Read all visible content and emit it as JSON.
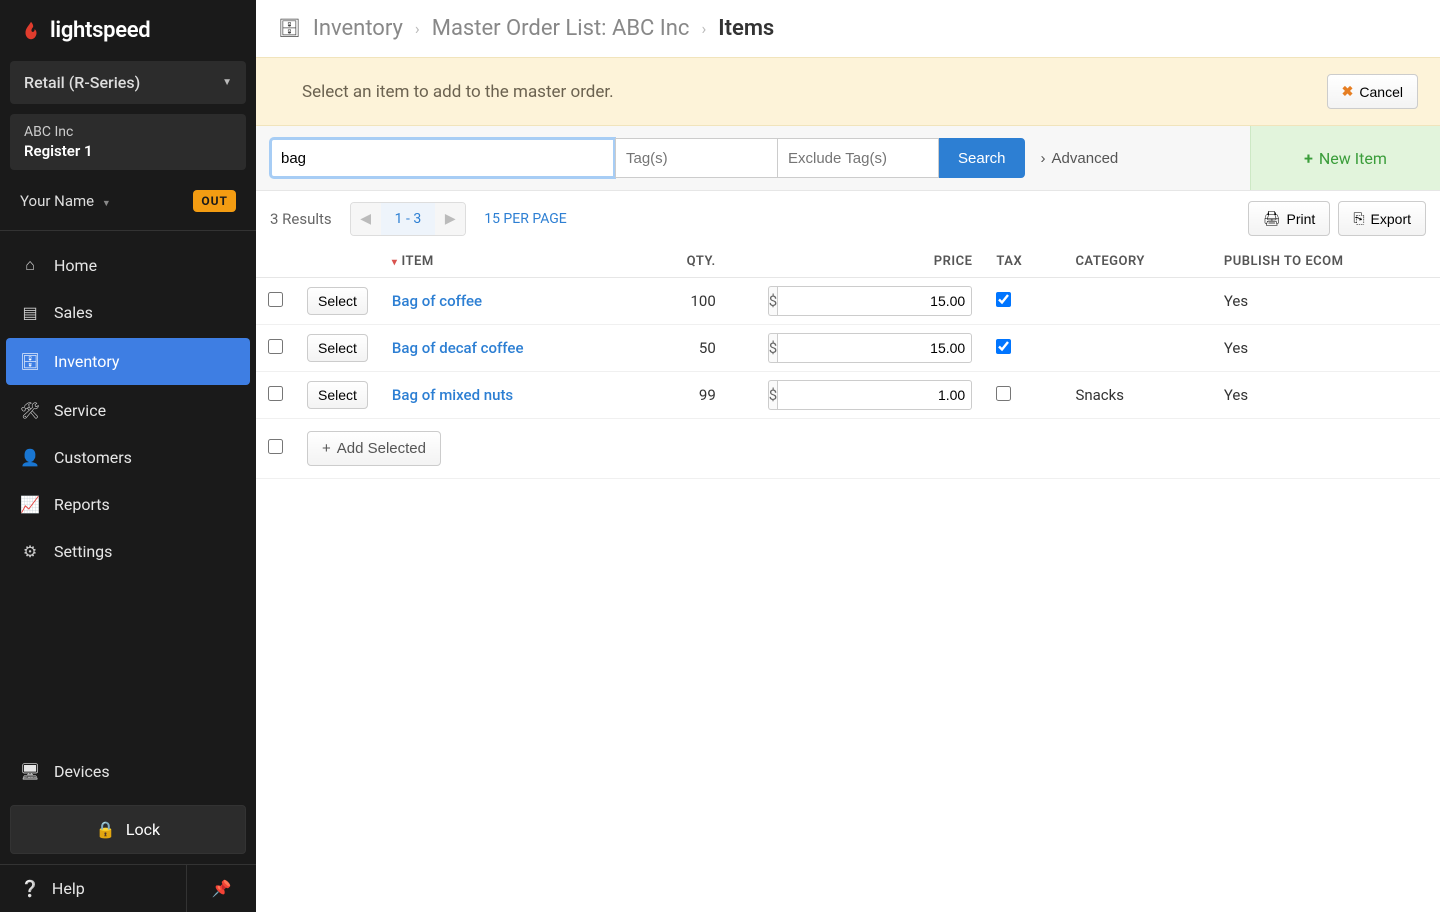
{
  "brand": "lightspeed",
  "product_selector": {
    "label": "Retail (R-Series)"
  },
  "location": {
    "company": "ABC Inc",
    "register": "Register 1"
  },
  "user": {
    "name": "Your Name",
    "status_badge": "OUT"
  },
  "nav": {
    "home": "Home",
    "sales": "Sales",
    "inventory": "Inventory",
    "service": "Service",
    "customers": "Customers",
    "reports": "Reports",
    "settings": "Settings",
    "devices": "Devices",
    "lock": "Lock",
    "help": "Help"
  },
  "breadcrumbs": {
    "inventory": "Inventory",
    "mol": "Master Order List:",
    "company": "ABC Inc",
    "items": "Items"
  },
  "notice": {
    "message": "Select an item to add to the master order.",
    "cancel": "Cancel"
  },
  "search": {
    "value": "bag",
    "tags_placeholder": "Tag(s)",
    "exclude_placeholder": "Exclude Tag(s)",
    "search_btn": "Search",
    "advanced": "Advanced",
    "new_item": "New Item"
  },
  "toolbar": {
    "results": "3 Results",
    "page_range": "1 - 3",
    "per_page": "15 PER PAGE",
    "print": "Print",
    "export": "Export"
  },
  "table": {
    "headers": {
      "item": "ITEM",
      "qty": "QTY.",
      "price": "PRICE",
      "tax": "TAX",
      "category": "CATEGORY",
      "ecom": "PUBLISH TO ECOM"
    },
    "select_label": "Select",
    "currency": "$",
    "rows": [
      {
        "name": "Bag of coffee",
        "qty": "100",
        "price": "15.00",
        "tax": true,
        "category": "",
        "ecom": "Yes"
      },
      {
        "name": "Bag of decaf coffee",
        "qty": "50",
        "price": "15.00",
        "tax": true,
        "category": "",
        "ecom": "Yes"
      },
      {
        "name": "Bag of mixed nuts",
        "qty": "99",
        "price": "1.00",
        "tax": false,
        "category": "Snacks",
        "ecom": "Yes"
      }
    ],
    "add_selected": "Add Selected"
  }
}
